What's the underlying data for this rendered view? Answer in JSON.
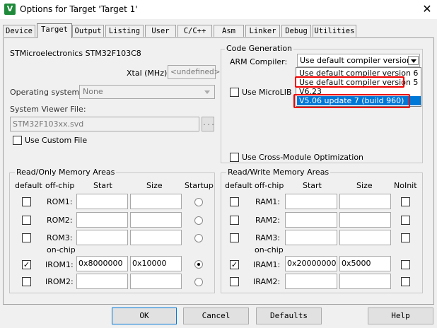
{
  "window": {
    "title": "Options for Target 'Target 1'",
    "icon_glyph": "V",
    "close_glyph": "✕"
  },
  "tabs": [
    "Device",
    "Target",
    "Output",
    "Listing",
    "User",
    "C/C++",
    "Asm",
    "Linker",
    "Debug",
    "Utilities"
  ],
  "active_tab": "Target",
  "device": {
    "name": "STMicroelectronics STM32F103C8",
    "xtal_label": "Xtal (MHz):",
    "xtal_value": "<undefined>",
    "os_label": "Operating system:",
    "os_value": "None",
    "svd_label": "System Viewer File:",
    "svd_value": "STM32F103xx.svd",
    "browse_label": "...",
    "custom_file_label": "Use Custom File"
  },
  "code_gen": {
    "title": "Code Generation",
    "compiler_label": "ARM Compiler:",
    "compiler_value": "Use default compiler version 5",
    "options": [
      "Use default compiler version 6",
      "Use default compiler version 5",
      "V6.23",
      "V5.06 update 7 (build 960)"
    ],
    "selected_index": 3,
    "microlib_label": "Use MicroLIB",
    "cross_module_label": "Use Cross-Module Optimization"
  },
  "ro_memory": {
    "title": "Read/Only Memory Areas",
    "headers": {
      "default": "default",
      "offchip": "off-chip",
      "start": "Start",
      "size": "Size",
      "startup": "Startup"
    },
    "onchip_label": "on-chip",
    "rows": [
      {
        "name": "ROM1:",
        "start": "",
        "size": "",
        "default": false,
        "startup": false
      },
      {
        "name": "ROM2:",
        "start": "",
        "size": "",
        "default": false,
        "startup": false
      },
      {
        "name": "ROM3:",
        "start": "",
        "size": "",
        "default": false,
        "startup": false
      },
      {
        "name": "IROM1:",
        "start": "0x8000000",
        "size": "0x10000",
        "default": true,
        "startup": true
      },
      {
        "name": "IROM2:",
        "start": "",
        "size": "",
        "default": false,
        "startup": false
      }
    ]
  },
  "rw_memory": {
    "title": "Read/Write Memory Areas",
    "headers": {
      "default": "default",
      "offchip": "off-chip",
      "start": "Start",
      "size": "Size",
      "noinit": "NoInit"
    },
    "onchip_label": "on-chip",
    "rows": [
      {
        "name": "RAM1:",
        "start": "",
        "size": "",
        "default": false,
        "noinit": false
      },
      {
        "name": "RAM2:",
        "start": "",
        "size": "",
        "default": false,
        "noinit": false
      },
      {
        "name": "RAM3:",
        "start": "",
        "size": "",
        "default": false,
        "noinit": false
      },
      {
        "name": "IRAM1:",
        "start": "0x20000000",
        "size": "0x5000",
        "default": true,
        "noinit": false
      },
      {
        "name": "IRAM2:",
        "start": "",
        "size": "",
        "default": false,
        "noinit": false
      }
    ]
  },
  "buttons": {
    "ok": "OK",
    "cancel": "Cancel",
    "defaults": "Defaults",
    "help": "Help"
  },
  "check_glyph": "✓",
  "colors": {
    "selection": "#0078d7",
    "highlight_box": "#e00000"
  }
}
